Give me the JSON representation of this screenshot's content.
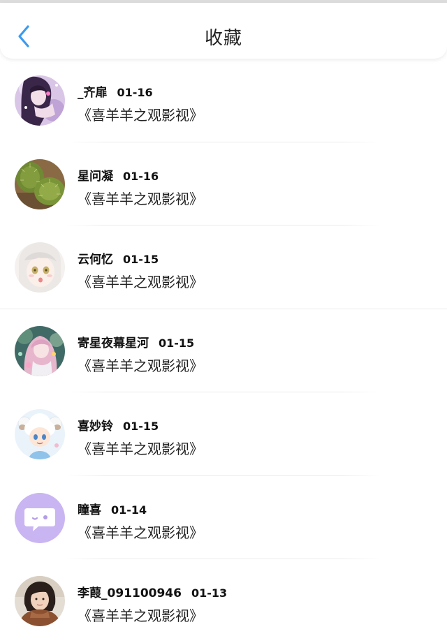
{
  "header": {
    "title": "收藏"
  },
  "items": [
    {
      "name": "_齐扉",
      "date": "01-16",
      "subtitle": "《喜羊羊之观影视》",
      "avatar": "anime-girl-avatar"
    },
    {
      "name": "星问凝",
      "date": "01-16",
      "subtitle": "《喜羊羊之观影视》",
      "avatar": "cactus-avatar"
    },
    {
      "name": "云何忆",
      "date": "01-15",
      "subtitle": "《喜羊羊之观影视》",
      "avatar": "white-hair-anime-avatar"
    },
    {
      "name": "寄星夜幕星河",
      "date": "01-15",
      "subtitle": "《喜羊羊之观影视》",
      "avatar": "pink-hair-anime-avatar"
    },
    {
      "name": "喜妙铃",
      "date": "01-15",
      "subtitle": "《喜羊羊之观影视》",
      "avatar": "sheep-chibi-avatar"
    },
    {
      "name": "瞳喜",
      "date": "01-14",
      "subtitle": "《喜羊羊之观影视》",
      "avatar": "default-chat-avatar"
    },
    {
      "name": "李葭_091100946",
      "date": "01-13",
      "subtitle": "《喜羊羊之观影视》",
      "avatar": "photo-avatar"
    }
  ],
  "colors": {
    "back_icon": "#3a9bf0",
    "default_avatar_bg": "#c9b5f2"
  }
}
